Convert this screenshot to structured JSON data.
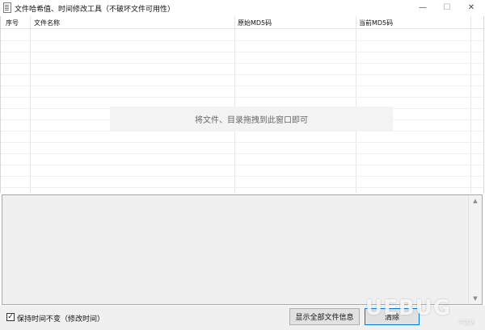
{
  "window": {
    "title": "文件哈希值、时间修改工具（不破坏文件可用性）",
    "icon": "document-icon",
    "controls": {
      "minimize": "—",
      "maximize": "☐",
      "close": "✕"
    }
  },
  "table": {
    "columns": [
      "序号",
      "文件名称",
      "原始MD5码",
      "当前MD5码"
    ],
    "rows": [],
    "drop_hint": "将文件、目录拖拽到此窗口即可"
  },
  "info_panel": {
    "value": ""
  },
  "bottom": {
    "checkbox_label": "保持时间不变（修改时间）",
    "checkbox_checked": "✓",
    "show_all_button": "显示全部文件信息",
    "clear_button": "清除"
  },
  "watermark": {
    "text": "UEBUG",
    "sub": "下载站"
  }
}
